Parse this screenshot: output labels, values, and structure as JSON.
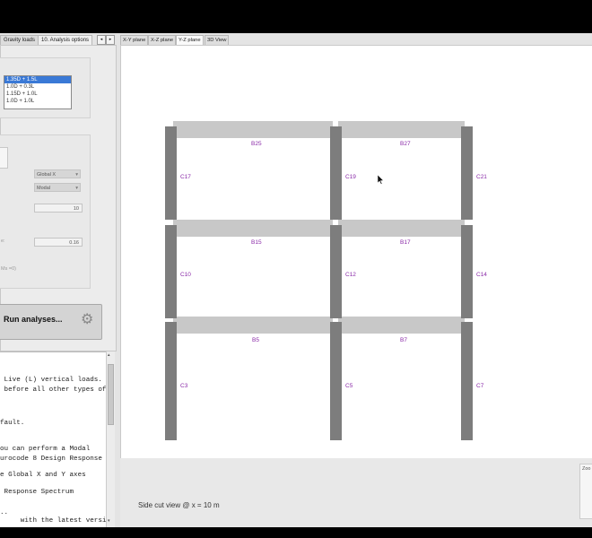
{
  "left_tabs": [
    {
      "label": "Gravity loads",
      "active": false
    },
    {
      "label": "10. Analysis options",
      "active": true
    }
  ],
  "load_combinations": [
    "1.35D + 1.5L",
    "1.0D + 0.3L",
    "1.15D + 1.0L",
    "1.0D + 1.0L"
  ],
  "selected_combination_index": 0,
  "options": {
    "direction_value": "Global X",
    "analysis_type_value": "Modal",
    "modes_value": "10",
    "param_label_fragment": "e:",
    "param_value": "0.16",
    "faint_note": "Ms =0)"
  },
  "run_button_label": "Run analyses...",
  "log_lines": [
    " Live (L) vertical loads.",
    " before all other types of",
    "",
    "fault.",
    "",
    "ou can perform a Modal",
    "urocode 8 Design Response",
    "",
    "e Global X and Y axes",
    "",
    " Response Spectrum",
    "",
    "..",
    "     with the latest version"
  ],
  "view_tabs": [
    {
      "label": "X-Y plane",
      "active": false
    },
    {
      "label": "X-Z plane",
      "active": false
    },
    {
      "label": "Y-Z plane",
      "active": true
    },
    {
      "label": "3D View",
      "active": false
    }
  ],
  "beams": [
    "B25",
    "B27",
    "B15",
    "B17",
    "B5",
    "B7"
  ],
  "columns": [
    "C17",
    "C19",
    "C21",
    "C10",
    "C12",
    "C14",
    "C3",
    "C5",
    "C7"
  ],
  "status_text": "Side cut view @ x = 10 m",
  "zoom_label": "Zoo",
  "colors": {
    "element_label": "#8a2aa8",
    "column": "#7d7d7d",
    "beam": "#c8c8c8",
    "selection": "#3a79d6"
  }
}
